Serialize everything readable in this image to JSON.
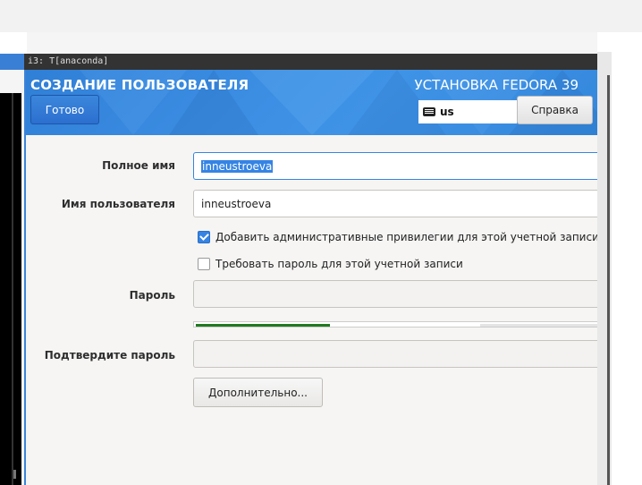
{
  "wm": {
    "title": "i3: T[anaconda]"
  },
  "header": {
    "title": "СОЗДАНИЕ ПОЛЬЗОВАТЕЛЯ",
    "product": "УСТАНОВКА FEDORA 39",
    "done_label": "Готово",
    "keyboard_layout": "us",
    "help_label": "Справка",
    "accent": "#3584e4"
  },
  "form": {
    "fullname_label": "Полное имя",
    "fullname_value": "inneustroeva",
    "username_label": "Имя пользователя",
    "username_value": "inneustroeva",
    "admin_checkbox_label": "Добавить административные привилегии для этой учетной записи по",
    "admin_checked": true,
    "require_password_label": "Требовать пароль для этой учетной записи",
    "require_password_checked": false,
    "password_label": "Пароль",
    "password_value": "",
    "password_strength": 0.33,
    "confirm_label": "Подтвердите пароль",
    "confirm_value": "",
    "advanced_label": "Дополнительно..."
  }
}
